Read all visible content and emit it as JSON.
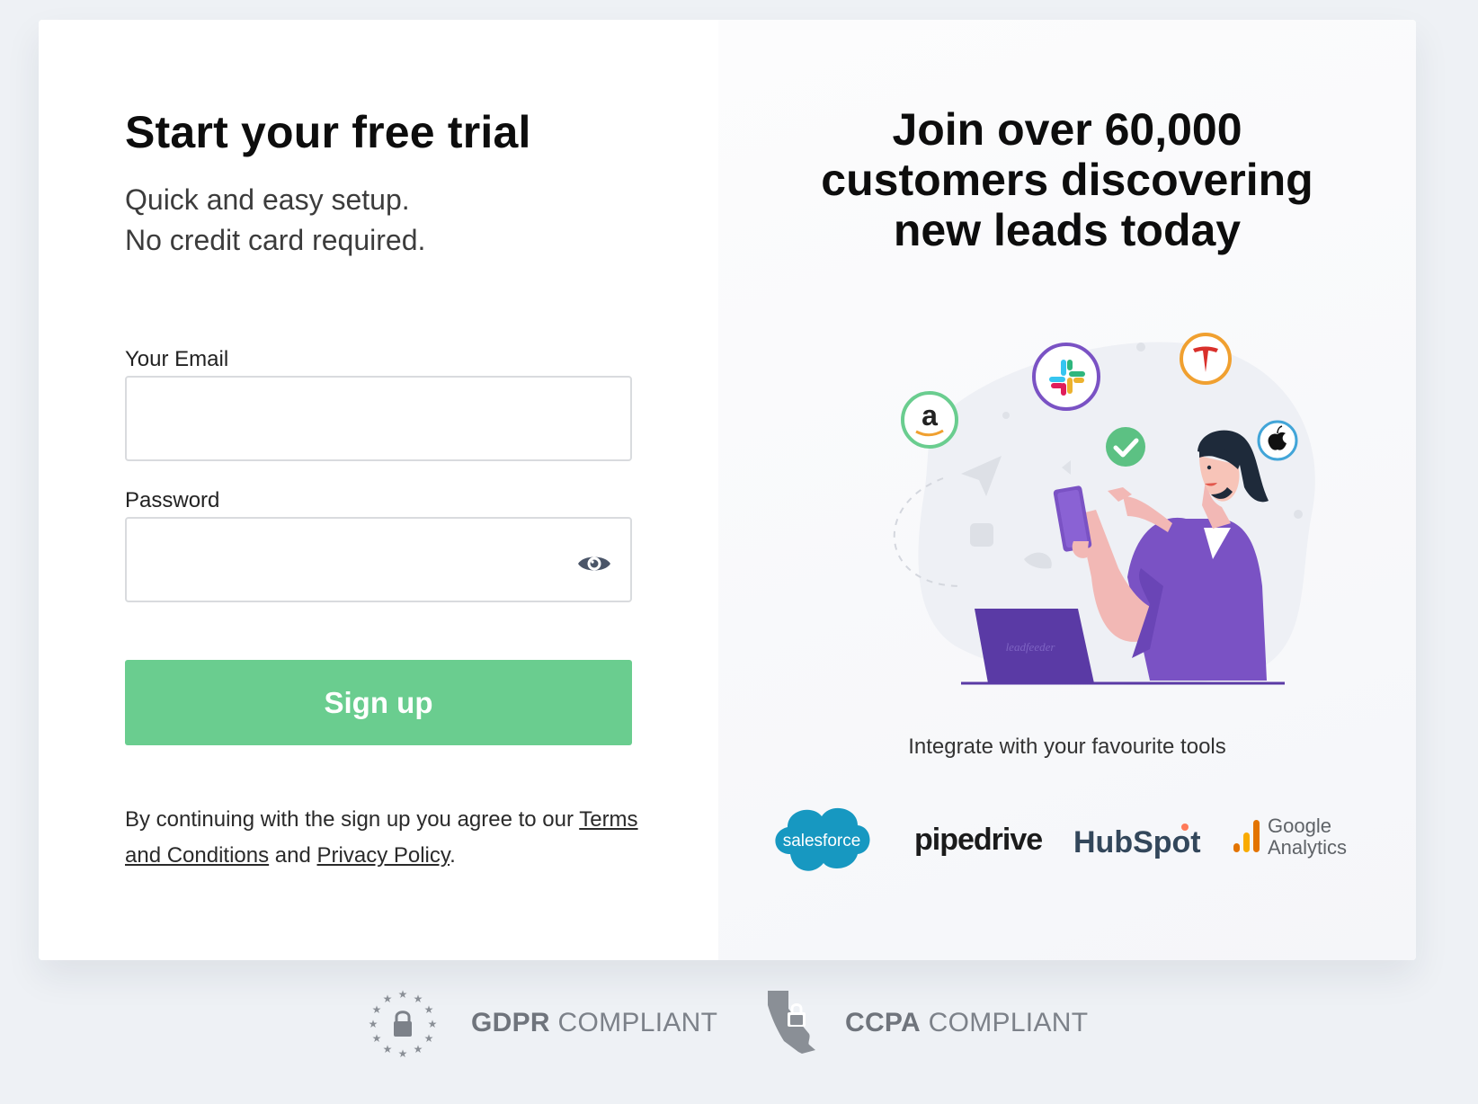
{
  "signup": {
    "title": "Start your free trial",
    "subtitle_line1": "Quick and easy setup.",
    "subtitle_line2": "No credit card required.",
    "email_label": "Your Email",
    "email_value": "",
    "password_label": "Password",
    "password_value": "",
    "submit_label": "Sign up",
    "legal_prefix": "By continuing with the sign up you agree to our",
    "terms_link": "Terms and Conditions",
    "legal_and": "and",
    "privacy_link": "Privacy Policy",
    "legal_suffix": "."
  },
  "promo": {
    "headline_line1": "Join over 60,000",
    "headline_line2": "customers discovering",
    "headline_line3": "new leads today",
    "integrate_text": "Integrate with your favourite tools",
    "illustration_laptop_text": "leadfeeder",
    "integrations": [
      {
        "name": "salesforce",
        "icon": "salesforce-logo"
      },
      {
        "name": "pipedrive",
        "icon": "pipedrive-logo"
      },
      {
        "name": "HubSpot",
        "icon": "hubspot-logo"
      },
      {
        "name_line1": "Google",
        "name_line2": "Analytics",
        "icon": "google-analytics-logo"
      }
    ]
  },
  "compliance": {
    "gdpr_bold": "GDPR",
    "gdpr_rest": "COMPLIANT",
    "ccpa_bold": "CCPA",
    "ccpa_rest": "COMPLIANT"
  },
  "colors": {
    "accent": "#6acd8f",
    "purple": "#7a52c4",
    "page_bg": "#eef1f5"
  }
}
